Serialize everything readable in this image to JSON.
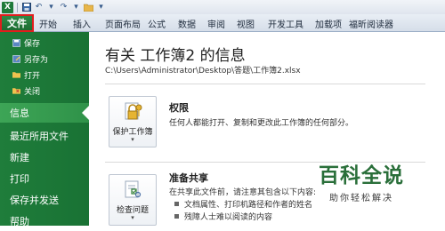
{
  "quick_access": {
    "icons": [
      "excel-logo",
      "save-icon",
      "undo-icon",
      "redo-icon",
      "open-folder-icon",
      "customize-icon"
    ]
  },
  "ribbon": {
    "file_tab": "文件",
    "tabs": [
      "开始",
      "插入",
      "页面布局",
      "公式",
      "数据",
      "审阅",
      "视图",
      "开发工具",
      "加载项",
      "福昕阅读器"
    ]
  },
  "sidebar": {
    "small_items": [
      {
        "label": "保存",
        "icon": "save-icon"
      },
      {
        "label": "另存为",
        "icon": "save-as-icon"
      },
      {
        "label": "打开",
        "icon": "open-folder-icon"
      },
      {
        "label": "关闭",
        "icon": "close-file-icon"
      }
    ],
    "big_items": [
      "信息",
      "最近所用文件",
      "新建",
      "打印",
      "保存并发送",
      "帮助"
    ],
    "active": "信息"
  },
  "main": {
    "title": "有关 工作簿2 的信息",
    "path": "C:\\Users\\Administrator\\Desktop\\答题\\工作簿2.xlsx",
    "permissions": {
      "button_label": "保护工作簿",
      "heading": "权限",
      "description": "任何人都能打开、复制和更改此工作簿的任何部分。"
    },
    "prepare": {
      "button_label": "检查问题",
      "heading": "准备共享",
      "description": "在共享此文件前，请注意其包含以下内容:",
      "bullets": [
        "文档属性、打印机路径和作者的姓名",
        "残障人士难以阅读的内容"
      ]
    }
  },
  "watermark": {
    "title": "百科全说",
    "subtitle": "助你轻松解决"
  },
  "colors": {
    "sidebar_green": "#1f7d3b",
    "active_green": "#3da556",
    "highlight_red": "#e11d1d"
  }
}
